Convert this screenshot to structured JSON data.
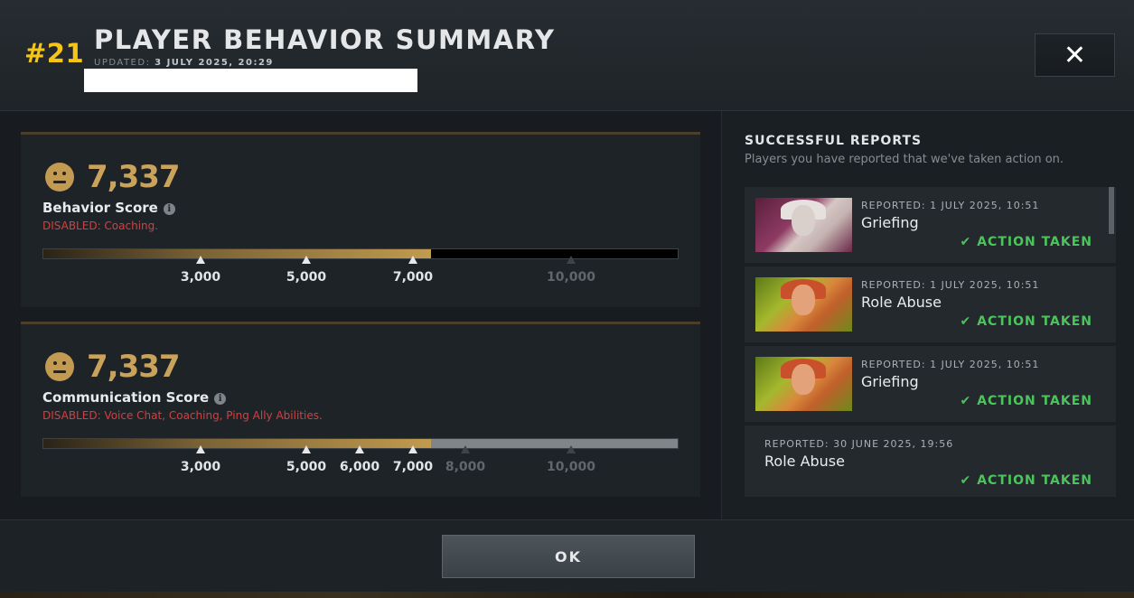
{
  "header": {
    "rank": "#21",
    "title": "PLAYER BEHAVIOR SUMMARY",
    "updated_label": "UPDATED:",
    "updated_value": "3 JULY 2025, 20:29",
    "close_label": "✕"
  },
  "behavior": {
    "score": "7,337",
    "score_value": 7337,
    "label": "Behavior Score",
    "disabled": "DISABLED:  Coaching.",
    "ticks": [
      "3,000",
      "5,000",
      "7,000",
      "10,000"
    ]
  },
  "communication": {
    "score": "7,337",
    "score_value": 7337,
    "label": "Communication Score",
    "disabled": "DISABLED:  Voice Chat, Coaching, Ping Ally Abilities.",
    "ticks": [
      "3,000",
      "5,000",
      "6,000",
      "7,000",
      "8,000",
      "10,000"
    ]
  },
  "reports": {
    "title": "SUCCESSFUL REPORTS",
    "subtitle": "Players you have reported that we've taken action on.",
    "items": [
      {
        "meta": "REPORTED: 1 JULY 2025, 10:51",
        "reason": "Griefing",
        "status": "ACTION TAKEN"
      },
      {
        "meta": "REPORTED: 1 JULY 2025, 10:51",
        "reason": "Role Abuse",
        "status": "ACTION TAKEN"
      },
      {
        "meta": "REPORTED: 1 JULY 2025, 10:51",
        "reason": "Griefing",
        "status": "ACTION TAKEN"
      },
      {
        "meta": "REPORTED: 30 JUNE 2025, 19:56",
        "reason": "Role Abuse",
        "status": "ACTION TAKEN"
      }
    ]
  },
  "footer": {
    "ok_label": "OK"
  },
  "colors": {
    "rank": "#f5c518",
    "score": "#c9a35b",
    "disabled": "#d24040",
    "action_taken": "#4cc45c"
  }
}
